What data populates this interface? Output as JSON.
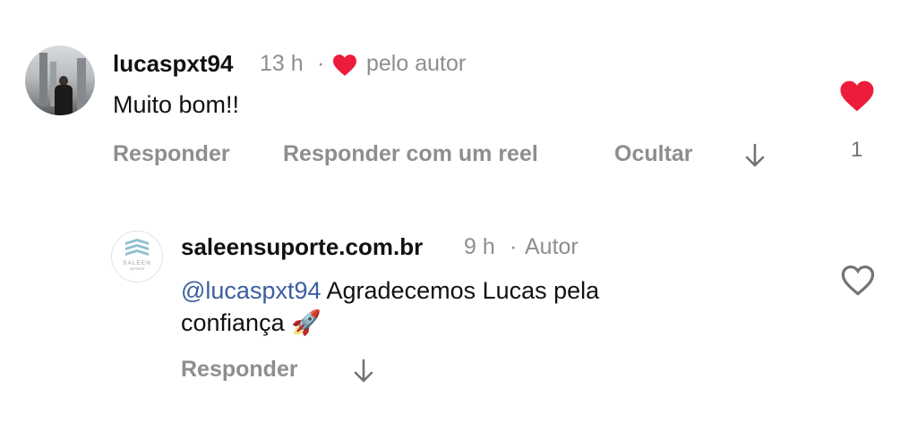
{
  "comments": [
    {
      "username": "lucaspxt94",
      "time": "13 h",
      "separator": "·",
      "author_like_label": "pelo autor",
      "text": "Muito bom!!",
      "actions": [
        "Responder",
        "Responder com um reel",
        "Ocultar"
      ],
      "like_count": "1",
      "liked": true
    }
  ],
  "reply": {
    "username": "saleensuporte.com.br",
    "time": "9 h",
    "separator": "·",
    "author_badge": "Autor",
    "mention": "@lucaspxt94",
    "text_line1": " Agradecemos Lucas pela",
    "text_line2": "confiança",
    "emoji": "🚀",
    "action": "Responder",
    "logo_text": "SALEEN",
    "logo_subtext": "SUPORTE"
  },
  "colors": {
    "heart_liked": "#ed1c3a",
    "meta_gray": "#8e8e8e",
    "mention_blue": "#3b5f9f"
  },
  "icons": {
    "show_replies": "arrow-down-icon",
    "like": "heart-icon"
  }
}
